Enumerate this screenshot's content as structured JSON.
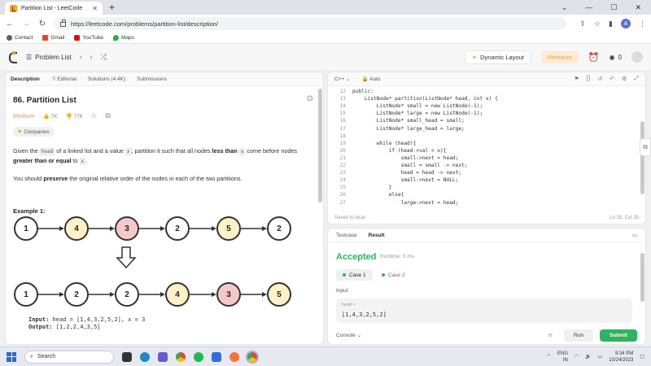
{
  "browser": {
    "tab_title": "Partition List - LeetCode",
    "new_tab_symbol": "+",
    "url": "https://leetcode.com/problems/partition-list/description/",
    "profile_initial": "A",
    "bookmarks": [
      {
        "label": "Contact",
        "color": "#5f6368"
      },
      {
        "label": "Gmail",
        "color": "#ea4335"
      },
      {
        "label": "YouTube",
        "color": "#ff0000"
      },
      {
        "label": "Maps",
        "color": "#34a853"
      }
    ]
  },
  "header": {
    "problem_list": "Problem List",
    "dynamic_layout": "Dynamic Layout",
    "premium": "Premium",
    "coins": "0"
  },
  "left_tabs": {
    "description": "Description",
    "editorial": "Editorial",
    "solutions": "Solutions (4.4K)",
    "submissions": "Submissions"
  },
  "problem": {
    "title": "86. Partition List",
    "difficulty": "Medium",
    "likes": "7K",
    "dislikes": "776",
    "companies": "Companies",
    "desc1_a": "Given the ",
    "desc1_code_head": "head",
    "desc1_b": " of a linked list and a value ",
    "desc1_code_x": "x",
    "desc1_c": ", partition it such that all nodes ",
    "desc1_bold1": "less than",
    "desc1_code_x2": "x",
    "desc1_d": " come before nodes ",
    "desc1_bold2": "greater than or equal",
    "desc1_e": " to ",
    "desc1_code_x3": "x",
    "desc1_f": ".",
    "desc2_a": "You should ",
    "desc2_bold": "preserve",
    "desc2_b": " the original relative order of the nodes in each of the two partitions.",
    "example_label": "Example 1:",
    "top_nodes": [
      {
        "v": "1",
        "c": "#ffffff"
      },
      {
        "v": "4",
        "c": "#fdf1c7"
      },
      {
        "v": "3",
        "c": "#f6c9c9"
      },
      {
        "v": "2",
        "c": "#ffffff"
      },
      {
        "v": "5",
        "c": "#fdf1c7"
      },
      {
        "v": "2",
        "c": "#ffffff"
      }
    ],
    "bottom_nodes": [
      {
        "v": "1",
        "c": "#ffffff"
      },
      {
        "v": "2",
        "c": "#ffffff"
      },
      {
        "v": "2",
        "c": "#ffffff"
      },
      {
        "v": "4",
        "c": "#fdf1c7"
      },
      {
        "v": "3",
        "c": "#f6c9c9"
      },
      {
        "v": "5",
        "c": "#fdf1c7"
      }
    ],
    "input_label": "Input:",
    "input_value": "head = [1,4,3,2,5,2], x = 3",
    "output_label": "Output:",
    "output_value": "[1,2,2,4,3,5]"
  },
  "editor": {
    "language": "C++",
    "mode": "Auto",
    "saved": "Saved to local",
    "cursor": "Ln 35, Col 35",
    "lines": [
      {
        "n": "12",
        "code": "public:"
      },
      {
        "n": "13",
        "code": "    ListNode* partition(ListNode* head, int x) {"
      },
      {
        "n": "14",
        "code": "        ListNode* small = new ListNode(-1);"
      },
      {
        "n": "15",
        "code": "        ListNode* large = new ListNode(-1);"
      },
      {
        "n": "16",
        "code": "        ListNode* small_head = small;"
      },
      {
        "n": "17",
        "code": "        ListNode* large_head = large;"
      },
      {
        "n": "18",
        "code": ""
      },
      {
        "n": "19",
        "code": "        while (head){"
      },
      {
        "n": "20",
        "code": "            if (head->val < x){"
      },
      {
        "n": "21",
        "code": "                small->next = head;"
      },
      {
        "n": "22",
        "code": "                small = small -> next;"
      },
      {
        "n": "23",
        "code": "                head = head -> next;"
      },
      {
        "n": "24",
        "code": "                small->next = NULL;"
      },
      {
        "n": "25",
        "code": "            }"
      },
      {
        "n": "26",
        "code": "            else{"
      },
      {
        "n": "27",
        "code": "                large->next = head;"
      }
    ]
  },
  "console": {
    "tab_testcase": "Testcase",
    "tab_result": "Result",
    "status": "Accepted",
    "runtime": "Runtime: 0 ms",
    "case1": "Case 1",
    "case2": "Case 2",
    "input_label": "Input",
    "var_name": "head =",
    "var_value": "[1,4,3,2,5,2]",
    "console_label": "Console",
    "run": "Run",
    "submit": "Submit"
  },
  "taskbar": {
    "search": "Search",
    "lang": "ENG",
    "region": "IN",
    "time": "9:34 PM",
    "date": "10/24/2023"
  }
}
